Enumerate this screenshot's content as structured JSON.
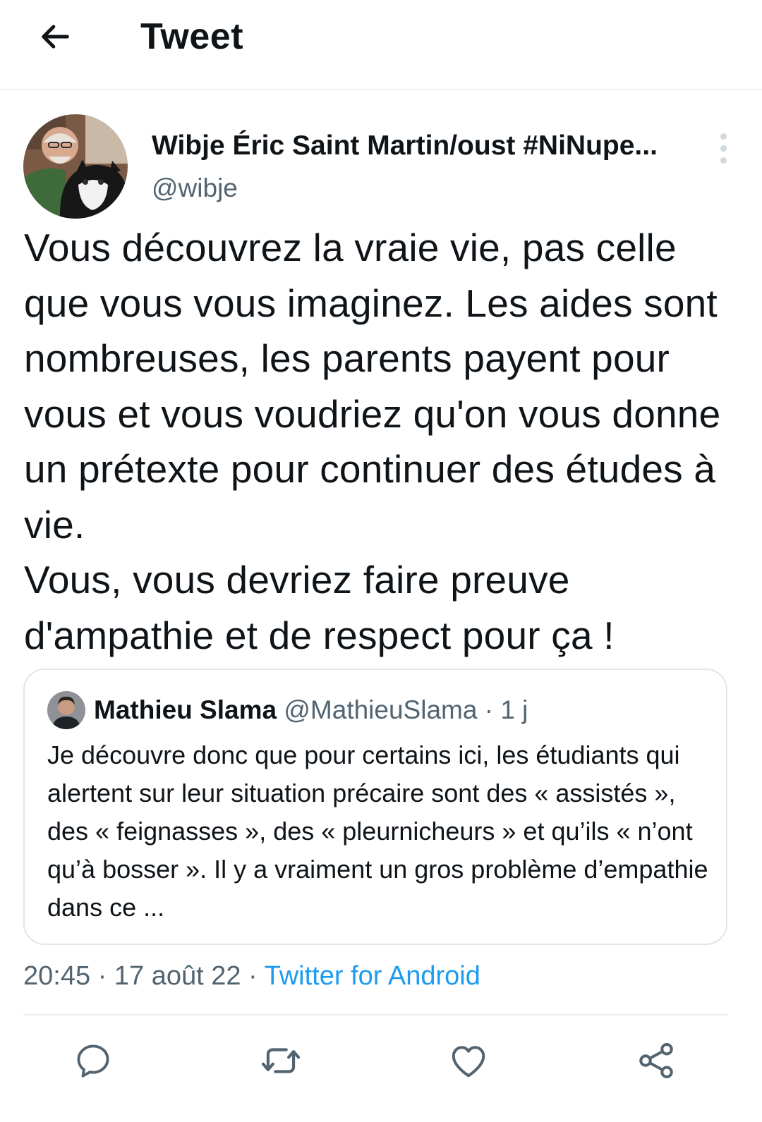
{
  "header": {
    "title": "Tweet",
    "back_icon": "arrow-left-icon"
  },
  "tweet": {
    "author_name": "Wibje Éric Saint Martin/oust #NiNupe...",
    "author_handle": "@wibje",
    "more_icon": "more-vertical-icon",
    "text": "Vous découvrez la vraie vie,  pas celle que vous vous imaginez.  Les aides sont nombreuses, les parents payent pour vous et vous voudriez qu'on vous donne un prétexte pour continuer des études à vie.\nVous,  vous devriez faire preuve d'ampathie et de respect pour ça !",
    "time": "20:45",
    "date": "17 août 22",
    "separator": "·",
    "source": "Twitter for Android"
  },
  "quote": {
    "author_name": "Mathieu Slama",
    "author_handle": "@MathieuSlama",
    "separator": "·",
    "age": "1 j",
    "text": "Je découvre donc que pour certains ici, les étudiants qui alertent sur leur situation précaire sont des « assistés », des « feignasses », des « pleurnicheurs » et qu’ils « n’ont qu’à bosser ». Il y a vraiment un gros problème d’empathie dans ce ..."
  },
  "actions": {
    "reply_icon": "reply-icon",
    "retweet_icon": "retweet-icon",
    "like_icon": "heart-icon",
    "share_icon": "share-icon"
  },
  "colors": {
    "text": "#0f1419",
    "secondary_text": "#536471",
    "link": "#1d9bf0",
    "border": "#e1e6ea"
  }
}
